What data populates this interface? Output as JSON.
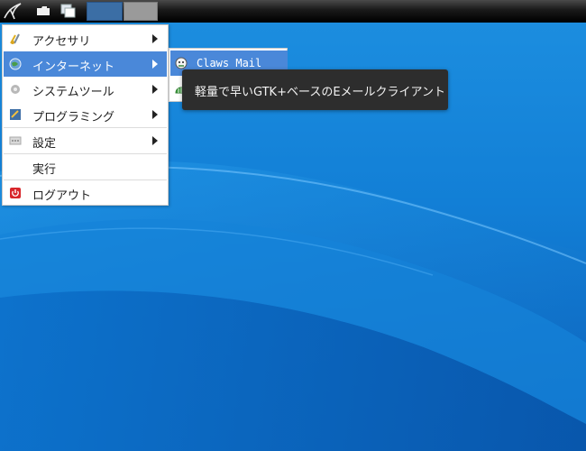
{
  "desktop": {
    "background_color": "#1a86d8"
  },
  "panel": {
    "launcher_icon": "lxde-bird-icon",
    "files_icon": "folder-icon",
    "windows_icon": "windows-icon",
    "task_buttons": [
      {
        "state": "active",
        "color": "#3b6ea5"
      },
      {
        "state": "inactive",
        "color": "#9a9a9a"
      }
    ]
  },
  "main_menu": {
    "items": [
      {
        "label": "アクセサリ",
        "icon": "accessories-icon",
        "has_submenu": true
      },
      {
        "label": "インターネット",
        "icon": "internet-globe-icon",
        "has_submenu": true,
        "active": true
      },
      {
        "label": "システムツール",
        "icon": "system-tools-gear-icon",
        "has_submenu": true
      },
      {
        "label": "プログラミング",
        "icon": "programming-icon",
        "has_submenu": true
      },
      {
        "label": "設定",
        "icon": "settings-icon",
        "has_submenu": true
      },
      {
        "label": "実行",
        "icon": "",
        "has_submenu": false
      },
      {
        "label": "ログアウト",
        "icon": "logout-power-icon",
        "has_submenu": false
      }
    ]
  },
  "internet_submenu": {
    "items": [
      {
        "label": "Claws Mail",
        "icon": "claws-mail-icon",
        "active": true
      },
      {
        "label": "",
        "icon": "network-app-icon",
        "active": false
      }
    ]
  },
  "tooltip": {
    "text": "軽量で早いGTK+ベースのEメールクライアント"
  },
  "colors": {
    "highlight": "#4a88d9",
    "tooltip_bg": "#2d2d2d",
    "menu_bg": "#ffffff"
  }
}
